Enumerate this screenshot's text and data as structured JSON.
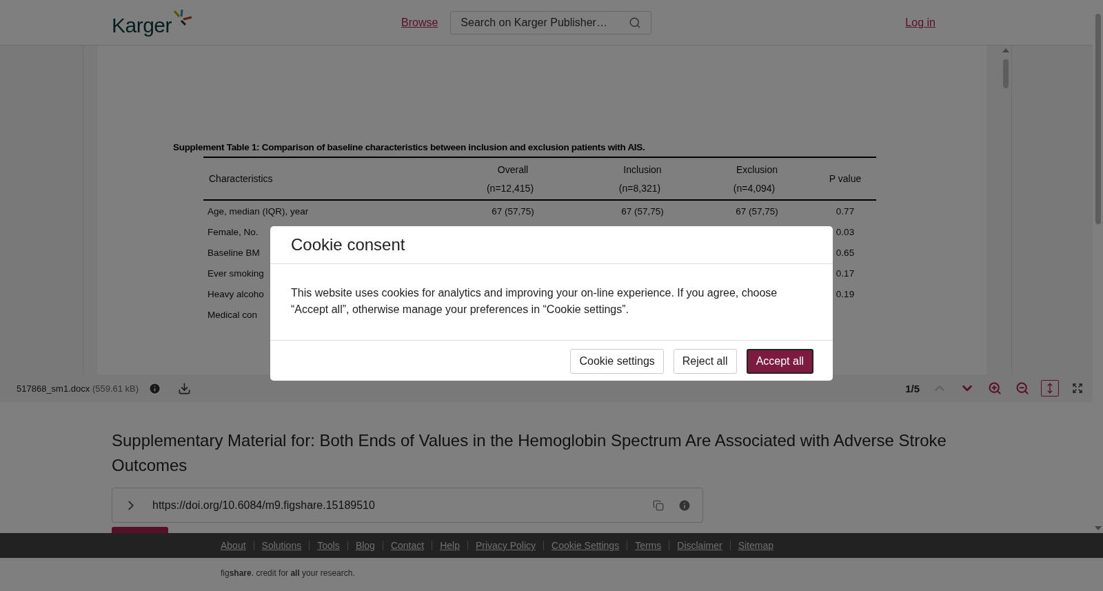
{
  "header": {
    "logo": "Karger",
    "nav_link": "Browse",
    "search": {
      "placeholder": "Search on Karger Publisher…"
    },
    "login": "Log in"
  },
  "document": {
    "table_title": "Supplement Table 1: Comparison of baseline characteristics between inclusion and exclusion patients with AIS.",
    "columns": [
      {
        "label": "Characteristics"
      },
      {
        "label": "Overall",
        "sub": "(n=12,415)"
      },
      {
        "label": "Inclusion",
        "sub": "(n=8,321)"
      },
      {
        "label": "Exclusion",
        "sub": "(n=4,094)"
      },
      {
        "label": "P value"
      }
    ],
    "rows": [
      {
        "label": "Age, median (IQR), year",
        "values": [
          "67 (57,75)",
          "67 (57,75)",
          "67 (57,75)"
        ],
        "p_value": "0.77"
      },
      {
        "label": "Female, No.",
        "p_value": "0.03"
      },
      {
        "label": "Baseline BM",
        "p_value": "0.65"
      },
      {
        "label": "Ever smoking",
        "p_value": "0.17"
      },
      {
        "label": "Heavy alcoho",
        "p_value": "0.19"
      },
      {
        "label": "Medical con"
      }
    ]
  },
  "viewer_toolbar": {
    "file_name": "517868_sm1.docx",
    "file_size": "(559.61 kB)",
    "page": "1/5",
    "buttons": [
      {
        "kind": "prev",
        "disabled": true,
        "active": false
      },
      {
        "kind": "next",
        "disabled": false,
        "active": false
      },
      {
        "kind": "zoom_in",
        "disabled": false,
        "active": false
      },
      {
        "kind": "zoom_out",
        "disabled": false,
        "active": false
      },
      {
        "kind": "fit",
        "disabled": false,
        "active": true
      },
      {
        "kind": "fullscreen",
        "disabled": false,
        "active": false
      }
    ]
  },
  "title": "Supplementary Material for: Both Ends of Values in the Hemoglobin Spectrum Are Associated with Adverse Stroke Outcomes",
  "doi": "https://doi.org/10.6084/m9.figshare.15189510",
  "footer": {
    "links": [
      "About",
      "Solutions",
      "Tools",
      "Blog",
      "Contact",
      "Help",
      "Privacy Policy",
      "Cookie Settings",
      "Terms",
      "Disclaimer",
      "Sitemap"
    ],
    "tagline": "fig**share**. credit for **all** your research."
  },
  "cookie_dialog": {
    "title": "Cookie consent",
    "body": "This website uses cookies for analytics and improving your on-line experience. If you agree, choose “Accept all”, otherwise manage your preferences in “Cookie settings”.",
    "buttons": [
      {
        "label": "Cookie settings",
        "primary": false
      },
      {
        "label": "Reject all",
        "primary": false
      },
      {
        "label": "Accept all",
        "primary": true
      }
    ]
  }
}
